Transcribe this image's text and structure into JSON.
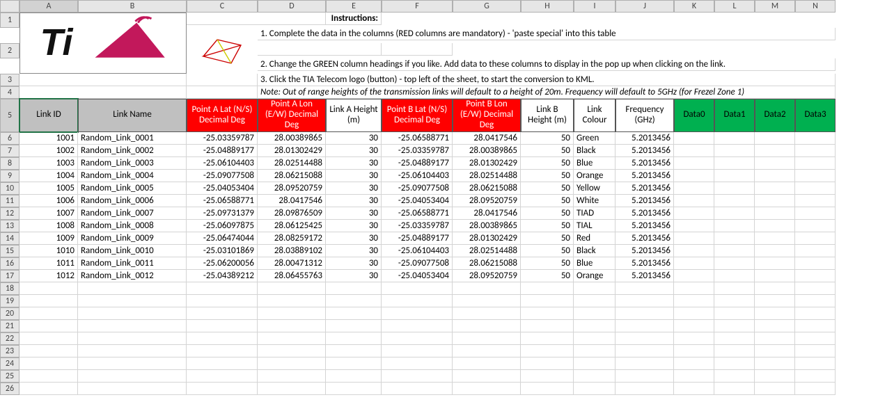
{
  "columns": [
    "A",
    "B",
    "C",
    "D",
    "E",
    "F",
    "G",
    "H",
    "I",
    "J",
    "K",
    "L",
    "M",
    "N"
  ],
  "row_numbers": [
    1,
    2,
    3,
    4,
    5,
    6,
    7,
    8,
    9,
    10,
    11,
    12,
    13,
    14,
    15,
    16,
    17,
    18,
    19,
    20,
    21,
    22,
    23,
    24,
    25,
    26
  ],
  "instructions_label": "Instructions:",
  "instructions": [
    "1. Complete the data in the columns (RED columns are mandatory) - 'paste special' into this table",
    "2. Change the GREEN column headings if you like. Add data to these columns to display in the pop up when clicking on the link.",
    "3. Click the TIA Telecom logo (button) - top left of the sheet, to start the conversion to KML."
  ],
  "note": "Note: Out of range heights of the transmission links will default to a height of 20m. Frequency will default to 5GHz (for Frezel Zone 1)",
  "headers": {
    "link_id": "Link ID",
    "link_name": "Link Name",
    "pa_lat": "Point A Lat (N/S) Decimal Deg",
    "pa_lon": "Point A Lon (E/W) Decimal Deg",
    "la_h": "Link A Height (m)",
    "pb_lat": "Point B Lat (N/S) Decimal Deg",
    "pb_lon": "Point B Lon (E/W) Decimal Deg",
    "lb_h": "Link B Height (m)",
    "colour": "Link Colour",
    "freq": "Frequency (GHz)",
    "d0": "Data0",
    "d1": "Data1",
    "d2": "Data2",
    "d3": "Data3"
  },
  "rows": [
    {
      "id": "1001",
      "name": "Random_Link_0001",
      "alat": "-25.03359787",
      "alon": "28.00389865",
      "ah": "30",
      "blat": "-25.06588771",
      "blon": "28.0417546",
      "bh": "50",
      "col": "Green",
      "freq": "5.2013456"
    },
    {
      "id": "1002",
      "name": "Random_Link_0002",
      "alat": "-25.04889177",
      "alon": "28.01302429",
      "ah": "30",
      "blat": "-25.03359787",
      "blon": "28.00389865",
      "bh": "50",
      "col": "Black",
      "freq": "5.2013456"
    },
    {
      "id": "1003",
      "name": "Random_Link_0003",
      "alat": "-25.06104403",
      "alon": "28.02514488",
      "ah": "30",
      "blat": "-25.04889177",
      "blon": "28.01302429",
      "bh": "50",
      "col": "Blue",
      "freq": "5.2013456"
    },
    {
      "id": "1004",
      "name": "Random_Link_0004",
      "alat": "-25.09077508",
      "alon": "28.06215088",
      "ah": "30",
      "blat": "-25.06104403",
      "blon": "28.02514488",
      "bh": "50",
      "col": "Orange",
      "freq": "5.2013456"
    },
    {
      "id": "1005",
      "name": "Random_Link_0005",
      "alat": "-25.04053404",
      "alon": "28.09520759",
      "ah": "30",
      "blat": "-25.09077508",
      "blon": "28.06215088",
      "bh": "50",
      "col": "Yellow",
      "freq": "5.2013456"
    },
    {
      "id": "1006",
      "name": "Random_Link_0006",
      "alat": "-25.06588771",
      "alon": "28.0417546",
      "ah": "30",
      "blat": "-25.04053404",
      "blon": "28.09520759",
      "bh": "50",
      "col": "White",
      "freq": "5.2013456"
    },
    {
      "id": "1007",
      "name": "Random_Link_0007",
      "alat": "-25.09731379",
      "alon": "28.09876509",
      "ah": "30",
      "blat": "-25.06588771",
      "blon": "28.0417546",
      "bh": "50",
      "col": "TIAD",
      "freq": "5.2013456"
    },
    {
      "id": "1008",
      "name": "Random_Link_0008",
      "alat": "-25.06097875",
      "alon": "28.06125425",
      "ah": "30",
      "blat": "-25.03359787",
      "blon": "28.00389865",
      "bh": "50",
      "col": "TIAL",
      "freq": "5.2013456"
    },
    {
      "id": "1009",
      "name": "Random_Link_0009",
      "alat": "-25.06474044",
      "alon": "28.08259172",
      "ah": "30",
      "blat": "-25.04889177",
      "blon": "28.01302429",
      "bh": "50",
      "col": "Red",
      "freq": "5.2013456"
    },
    {
      "id": "1010",
      "name": "Random_Link_0010",
      "alat": "-25.03101869",
      "alon": "28.03889102",
      "ah": "30",
      "blat": "-25.06104403",
      "blon": "28.02514488",
      "bh": "50",
      "col": "Black",
      "freq": "5.2013456"
    },
    {
      "id": "1011",
      "name": "Random_Link_0011",
      "alat": "-25.06200056",
      "alon": "28.00471312",
      "ah": "30",
      "blat": "-25.09077508",
      "blon": "28.06215088",
      "bh": "50",
      "col": "Blue",
      "freq": "5.2013456"
    },
    {
      "id": "1012",
      "name": "Random_Link_0012",
      "alat": "-25.04389212",
      "alon": "28.06455763",
      "ah": "30",
      "blat": "-25.04053404",
      "blon": "28.09520759",
      "bh": "50",
      "col": "Orange",
      "freq": "5.2013456"
    }
  ]
}
